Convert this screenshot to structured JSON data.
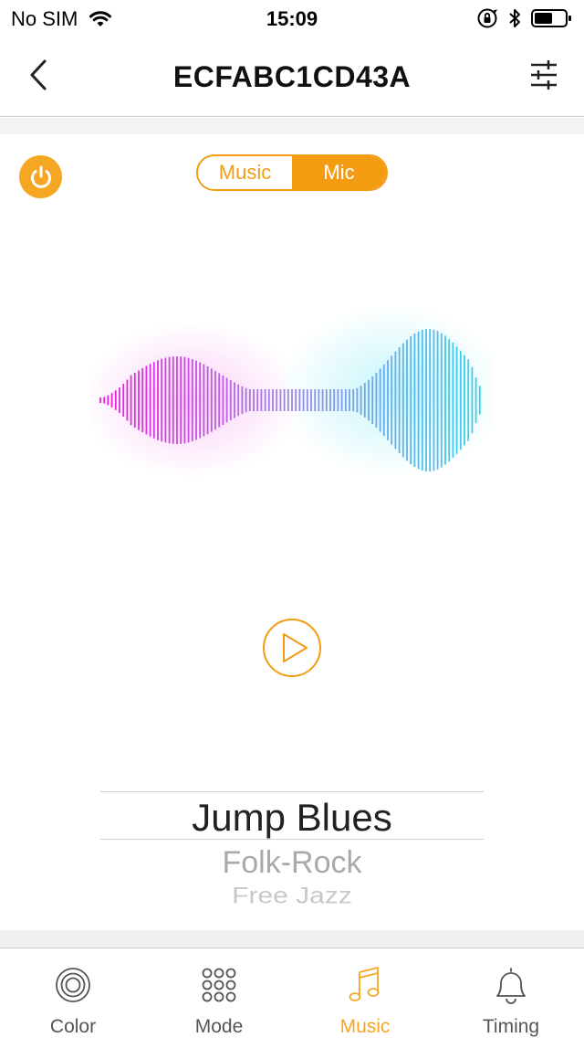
{
  "status_bar": {
    "carrier": "No SIM",
    "time": "15:09"
  },
  "nav": {
    "title": "ECFABC1CD43A"
  },
  "source_toggle": {
    "options": [
      "Music",
      "Mic"
    ],
    "selected": "Mic"
  },
  "genre_picker": {
    "items": [
      "Jump Blues",
      "Folk-Rock",
      "Free Jazz"
    ],
    "selected": "Jump Blues"
  },
  "tabs": [
    {
      "label": "Color",
      "icon": "color-icon"
    },
    {
      "label": "Mode",
      "icon": "mode-icon"
    },
    {
      "label": "Music",
      "icon": "music-note-icon"
    },
    {
      "label": "Timing",
      "icon": "bell-icon"
    }
  ],
  "active_tab": "Music",
  "colors": {
    "accent": "#f5a623",
    "toggle_border": "#f39c12",
    "wave_start": "#e81ed9",
    "wave_end": "#35d3ec"
  }
}
